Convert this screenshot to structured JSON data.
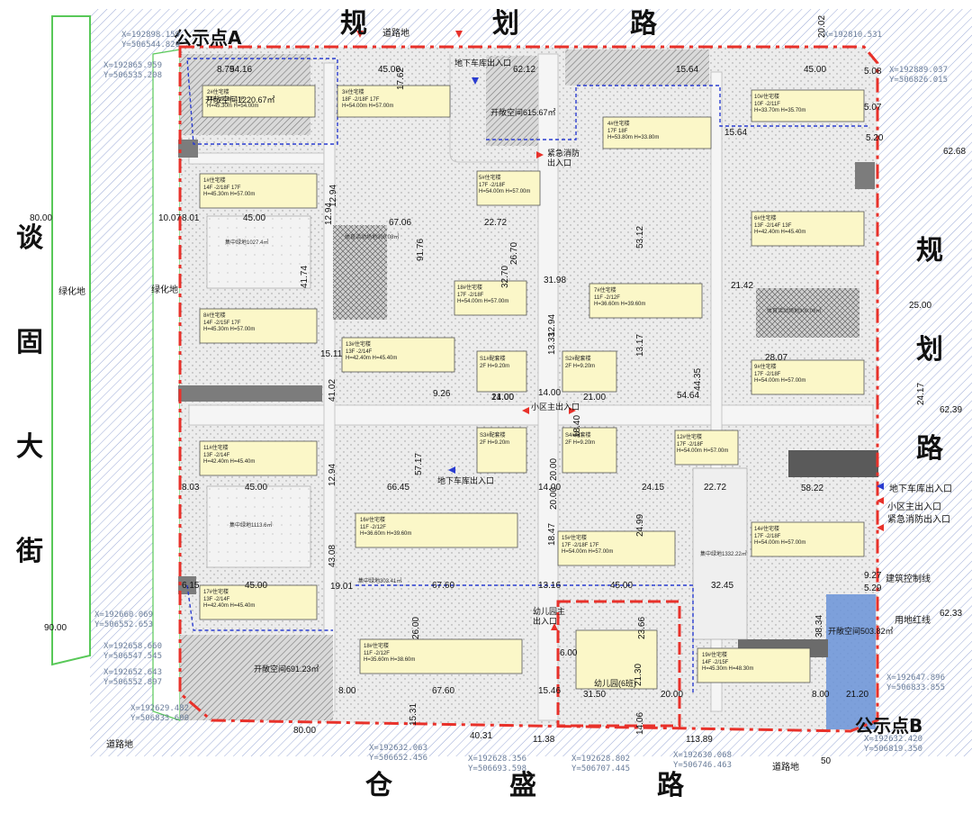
{
  "roads": {
    "north": [
      "规",
      "划",
      "路"
    ],
    "east": [
      "规",
      "划",
      "路"
    ],
    "south": [
      "仓",
      "盛",
      "路"
    ],
    "west": [
      "谈",
      "固",
      "大",
      "街"
    ]
  },
  "corner_points": {
    "a": "公示点A",
    "b": "公示点B"
  },
  "coordinates": [
    {
      "x": "X=192898.159",
      "y": "Y=506544.820"
    },
    {
      "x": "X=192865.959",
      "y": "Y=506535.208"
    },
    {
      "x": "X=192810.531",
      "y": ""
    },
    {
      "x": "X=192889.037",
      "y": "Y=506826.015"
    },
    {
      "x": "X=192660.069",
      "y": "Y=506552.653"
    },
    {
      "x": "X=192658.660",
      "y": "Y=506547.545"
    },
    {
      "x": "X=192652.643",
      "y": "Y=506552.897"
    },
    {
      "x": "X=192629.482",
      "y": "Y=506833.600"
    },
    {
      "x": "X=192632.063",
      "y": "Y=506652.456"
    },
    {
      "x": "X=192628.356",
      "y": "Y=506693.598"
    },
    {
      "x": "X=192628.802",
      "y": "Y=506707.445"
    },
    {
      "x": "X=192630.068",
      "y": "Y=506746.463"
    },
    {
      "x": "X=192647.896",
      "y": "Y=506833.855"
    },
    {
      "x": "X=192632.420",
      "y": "Y=506819.350"
    }
  ],
  "side_labels": {
    "road_land": "道路地",
    "green_land": "绿化地",
    "building_control": "建筑控制线",
    "land_red_line": "用地红线",
    "garage_entry_a": "地下车库出入口",
    "main_entry": "小区主出入口",
    "emergency_entry": "紧急消防出入口",
    "fire_entry_north": "紧急消防\n出入口",
    "ground_entry_north": "地下车库出入口",
    "community_main_entry": "小区主出入口",
    "garage_entry_mid": "地下车库出入口",
    "kindergarten_entry": "幼儿园主\n出入口",
    "kindergarten": "幼儿园(6班)"
  },
  "open_spaces": [
    "开敞空间1220.67㎡",
    "开敞空间615.67㎡",
    "开敞空间691.23㎡",
    "开敞空间503.82㎡"
  ],
  "greens": [
    "集中绿地1027.4㎡",
    "集中绿地1113.6㎡",
    "集中绿地303.41㎡",
    "集中绿地1332.22㎡"
  ],
  "sports": [
    "体育活动场地300.08㎡",
    "体育活动场地300.08㎡"
  ],
  "buildings": [
    {
      "name": "2#住宅楼",
      "info": "14F -2/18F 17F\nH=45.30m H=54.00m"
    },
    {
      "name": "3#住宅楼",
      "info": "18F -2/18F 17F\nH=54.00m H=57.00m"
    },
    {
      "name": "4#住宅楼",
      "info": "17F 18F\nH=53.80m H=33.80m"
    },
    {
      "name": "10#住宅楼",
      "info": "10F -2/11F\nH=33.70m H=35.70m"
    },
    {
      "name": "1#住宅楼",
      "info": "14F -2/18F 17F\nH=45.30m H=57.00m"
    },
    {
      "name": "5#住宅楼",
      "info": "17F -2/18F\nH=54.00m H=57.00m"
    },
    {
      "name": "6#住宅楼",
      "info": "13F -2/14F 13F\nH=42.40m H=45.40m"
    },
    {
      "name": "9#住宅楼",
      "info": "17F -2/18F\nH=54.00m H=57.00m"
    },
    {
      "name": "7#住宅楼",
      "info": "11F -2/12F\nH=36.60m H=39.60m"
    },
    {
      "name": "8#住宅楼",
      "info": "14F -2/15F 17F\nH=45.30m H=57.00m"
    },
    {
      "name": "13#住宅楼",
      "info": "13F -2/14F\nH=42.40m H=45.40m"
    },
    {
      "name": "18#住宅楼",
      "info": "17F -2/18F\nH=54.00m H=57.00m"
    },
    {
      "name": "11#住宅楼",
      "info": "13F -2/14F\nH=42.40m H=45.40m"
    },
    {
      "name": "12#住宅楼",
      "info": "17F -2/18F\nH=54.00m H=57.00m"
    },
    {
      "name": "16#住宅楼",
      "info": "11F -2/12F\nH=36.60m H=39.60m"
    },
    {
      "name": "15#住宅楼",
      "info": "17F -2/18F 17F\nH=54.00m H=57.00m"
    },
    {
      "name": "14#住宅楼",
      "info": "17F -2/18F\nH=54.00m H=57.00m"
    },
    {
      "name": "17#住宅楼",
      "info": "13F -2/14F\nH=42.40m H=45.40m"
    },
    {
      "name": "18#住宅楼",
      "info": "11F -2/12F\nH=35.60m H=38.60m"
    },
    {
      "name": "19#住宅楼",
      "info": "14F -2/15F\nH=45.30m H=48.30m"
    },
    {
      "name": "S1#配套楼",
      "info": "2F H=9.20m"
    },
    {
      "name": "S2#配套楼",
      "info": "2F H=9.20m"
    },
    {
      "name": "S3#配套楼",
      "info": "2F H=9.20m"
    },
    {
      "name": "S4#配套楼",
      "info": "2F H=9.20m"
    }
  ],
  "dimensions": [
    "80.00",
    "10.07",
    "8.01",
    "45.00",
    "67.06",
    "12.94",
    "41.74",
    "91.76",
    "22.72",
    "32.70",
    "31.98",
    "12.94",
    "53.12",
    "21.42",
    "25.00",
    "28.07",
    "54.64",
    "44.35",
    "24.17",
    "26.70",
    "13.33",
    "13.17",
    "12.94",
    "14.00",
    "21.00",
    "21.00",
    "20.00",
    "18.40",
    "45.00",
    "41.02",
    "8.79",
    "17.62",
    "45.00",
    "62.12",
    "15.64",
    "45.00",
    "5.08",
    "5.07",
    "5.20",
    "15.64",
    "20.02",
    "54.16",
    "12.94",
    "9.26",
    "14.00",
    "66.45",
    "57.17",
    "20.00",
    "18.47",
    "14.00",
    "24.15",
    "24.99",
    "22.72",
    "58.22",
    "32.45",
    "43.08",
    "15.11",
    "8.03",
    "45.00",
    "67.60",
    "13.16",
    "19.01",
    "6.15",
    "26.00",
    "45.00",
    "9.27",
    "5.29",
    "23.66",
    "38.34",
    "90.00",
    "8.00",
    "67.60",
    "15.46",
    "21.30",
    "20.00",
    "15.31",
    "31.50",
    "14.06",
    "6.00",
    "8.00",
    "21.20",
    "80.00",
    "40.31",
    "11.38",
    "113.89",
    "50",
    "62.68",
    "62.39",
    "62.33"
  ],
  "colors": {
    "red_line": "#e8312a",
    "blue_line": "#2a3cd0",
    "green_belt": "#58c858",
    "building_fill": "#fbf7c8",
    "hatch_gray": "#8f8f8f",
    "blue_fill": "#6a93d8"
  }
}
